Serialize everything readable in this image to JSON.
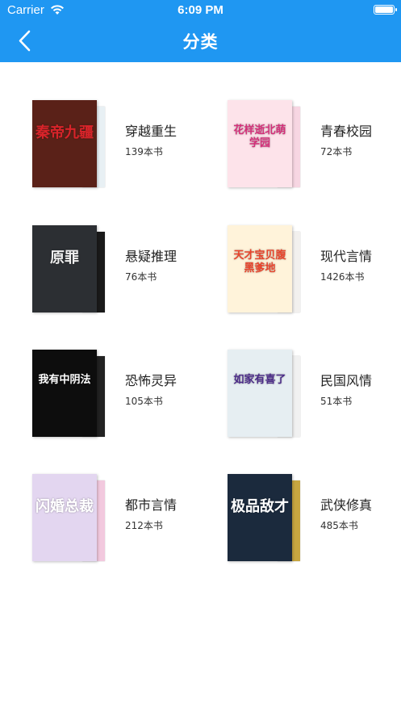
{
  "status": {
    "carrier": "Carrier",
    "time": "6:09 PM"
  },
  "nav": {
    "title": "分类"
  },
  "categories": [
    {
      "name": "穿越重生",
      "count": "139本书",
      "cover_text": "秦帝九疆",
      "front_color": "#5a2118",
      "back_color": "#e8f0f4",
      "text_color": "#d8242a"
    },
    {
      "name": "青春校园",
      "count": "72本书",
      "cover_text": "花样逝北萌学园",
      "front_color": "#fde3ea",
      "back_color": "#f7d6e2",
      "text_color": "#d4307a"
    },
    {
      "name": "悬疑推理",
      "count": "76本书",
      "cover_text": "原罪",
      "front_color": "#2c2f33",
      "back_color": "#1a1a1a",
      "text_color": "#eeeeee"
    },
    {
      "name": "现代言情",
      "count": "1426本书",
      "cover_text": "天才宝贝腹黑爹地",
      "front_color": "#fff3da",
      "back_color": "#f2f0ee",
      "text_color": "#e8442c"
    },
    {
      "name": "恐怖灵异",
      "count": "105本书",
      "cover_text": "我有中阴法",
      "front_color": "#0d0d0d",
      "back_color": "#222222",
      "text_color": "#ffffff"
    },
    {
      "name": "民国风情",
      "count": "51本书",
      "cover_text": "如家有喜了",
      "front_color": "#e6eef2",
      "back_color": "#f1f1f1",
      "text_color": "#4b2a88"
    },
    {
      "name": "都市言情",
      "count": "212本书",
      "cover_text": "闪婚总裁",
      "front_color": "#e3d6f0",
      "back_color": "#f2c9de",
      "text_color": "#ffffff"
    },
    {
      "name": "武侠修真",
      "count": "485本书",
      "cover_text": "极品敌才",
      "front_color": "#1b2a3d",
      "back_color": "#c7a640",
      "text_color": "#ffffff"
    }
  ]
}
